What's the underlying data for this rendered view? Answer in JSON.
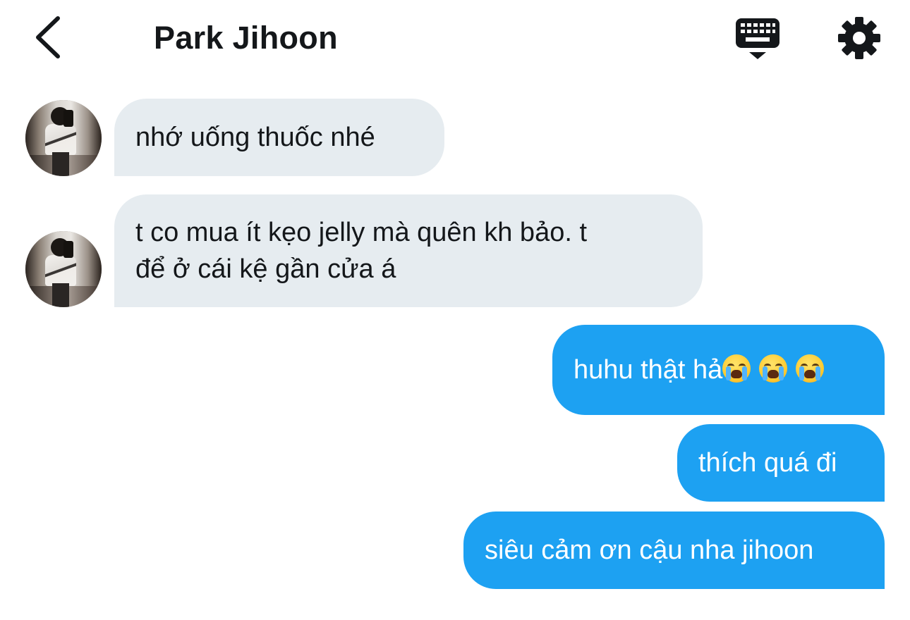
{
  "header": {
    "title": "Park Jihoon",
    "back_icon": "chevron-left-icon",
    "keyboard_icon": "keyboard-dismiss-icon",
    "settings_icon": "gear-icon"
  },
  "messages": [
    {
      "direction": "incoming",
      "text": "nhớ uống thuốc nhé"
    },
    {
      "direction": "incoming",
      "line1": "t co mua ít kẹo jelly mà quên kh bảo. t",
      "line2": "để ở cái kệ gần cửa á"
    },
    {
      "direction": "outgoing",
      "text": "huhu thật hả",
      "emoji_name": "loudly-crying-face-emoji",
      "emoji_count": 3
    },
    {
      "direction": "outgoing",
      "text": "thích quá đi"
    },
    {
      "direction": "outgoing",
      "text": "siêu cảm ơn cậu nha jihoon"
    }
  ],
  "colors": {
    "incoming_bubble": "#e6ecf0",
    "outgoing_bubble": "#1da1f2",
    "outgoing_text": "#ffffff",
    "text": "#14171a"
  }
}
